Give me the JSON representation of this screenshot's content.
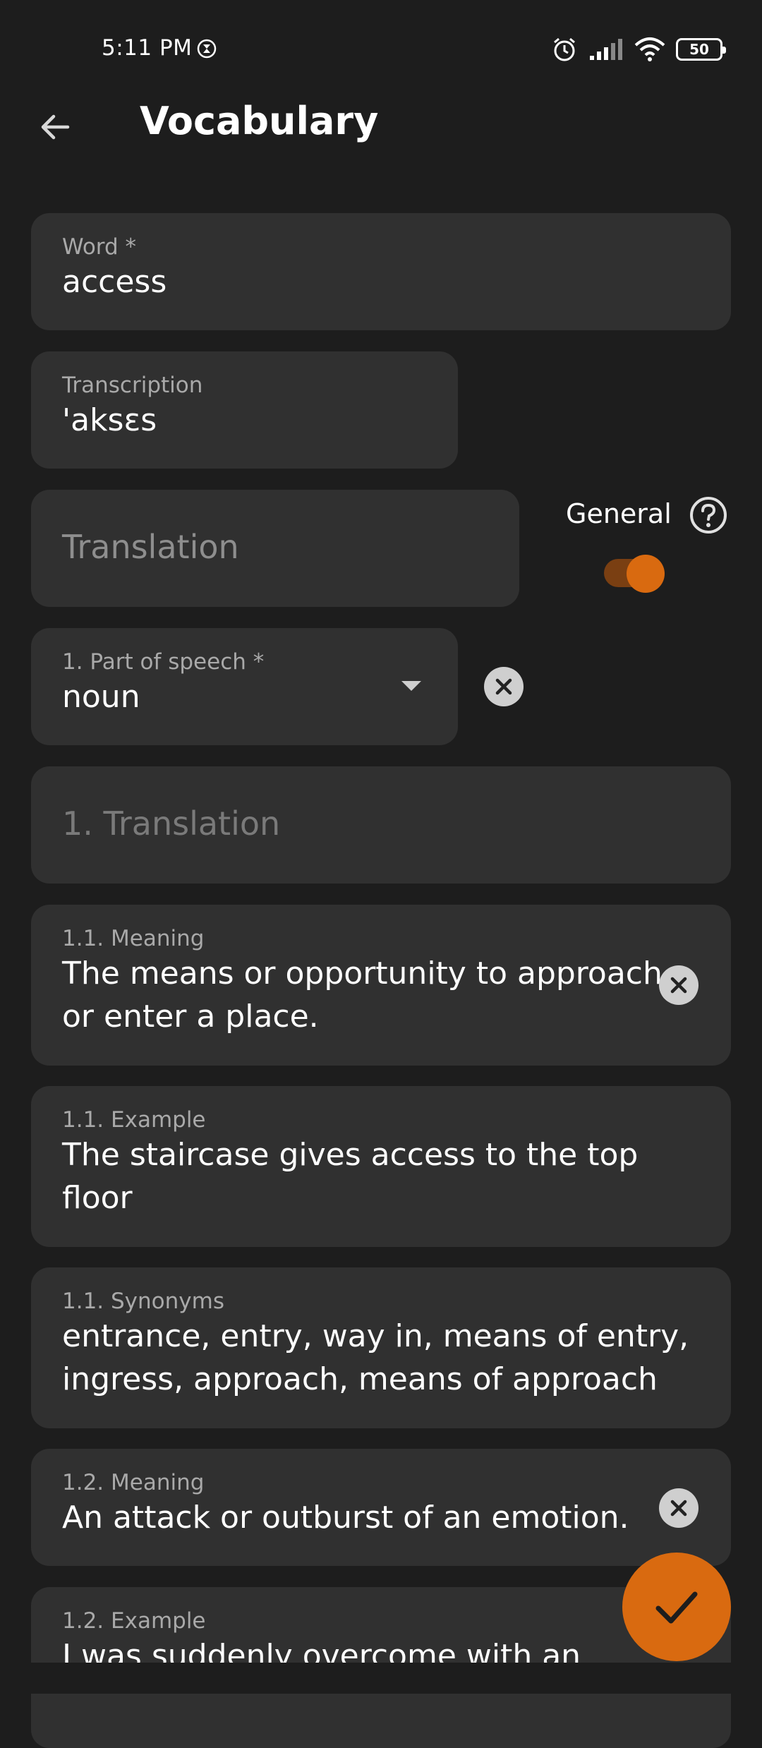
{
  "status_bar": {
    "time": "5:11 PM",
    "battery": "50",
    "icons": [
      "timer-icon",
      "alarm-icon",
      "signal-icon",
      "wifi-icon",
      "battery-icon"
    ]
  },
  "app_bar": {
    "title": "Vocabulary",
    "back_icon": "arrow-back-icon"
  },
  "form": {
    "word": {
      "label": "Word *",
      "value": "access"
    },
    "transcription": {
      "label": "Transcription",
      "value": "'aksɛs"
    },
    "translation": {
      "placeholder": "Translation"
    },
    "general": {
      "label": "General",
      "enabled": true
    },
    "part_of_speech": {
      "label": "1. Part of speech *",
      "value": "noun"
    },
    "translation_1": {
      "placeholder": "1. Translation"
    },
    "meaning_1_1": {
      "label": "1.1. Meaning",
      "value": "The means or opportunity to approach or enter a place."
    },
    "example_1_1": {
      "label": "1.1. Example",
      "value": "The staircase gives access to the top floor"
    },
    "synonyms_1_1": {
      "label": "1.1. Synonyms",
      "value": "entrance, entry, way in, means of entry, ingress, approach, means of approach"
    },
    "meaning_1_2": {
      "label": "1.2. Meaning",
      "value": "An attack or outburst of an emotion."
    },
    "example_1_2": {
      "label": "1.2. Example",
      "value": "I was suddenly overcome with an"
    }
  },
  "colors": {
    "background": "#1d1d1d",
    "field": "#303030",
    "accent": "#d96a10"
  },
  "fab_icon": "check-icon"
}
